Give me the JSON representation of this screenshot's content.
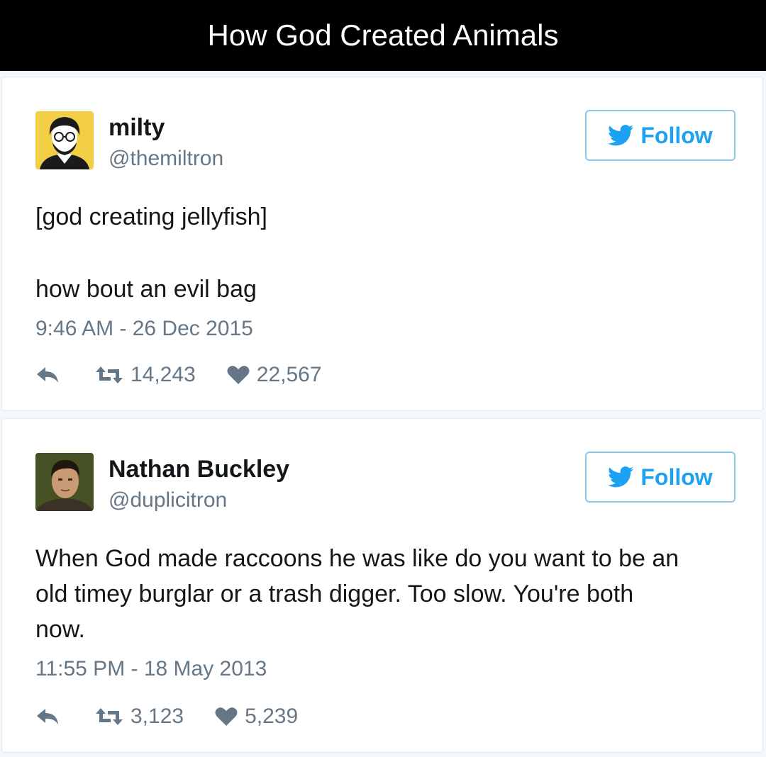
{
  "header": {
    "title": "How God Created Animals"
  },
  "tweets": [
    {
      "name": "milty",
      "handle": "@themiltron",
      "follow_label": "Follow",
      "text_line1": "[god creating jellyfish]",
      "text_line2": "how bout an evil bag",
      "timestamp": "9:46 AM - 26 Dec 2015",
      "retweets": "14,243",
      "likes": "22,567"
    },
    {
      "name": "Nathan Buckley",
      "handle": "@duplicitron",
      "follow_label": "Follow",
      "text_line1": "When God made raccoons he was like do you want to be an",
      "text_line2": "old timey burglar or a trash digger. Too slow. You're both",
      "text_line3": "now.",
      "timestamp": "11:55 PM - 18 May 2013",
      "retweets": "3,123",
      "likes": "5,239"
    }
  ],
  "colors": {
    "accent": "#1da1f2",
    "muted": "#657786",
    "text": "#14171a"
  },
  "icons": [
    "twitter-bird-icon",
    "reply-icon",
    "retweet-icon",
    "heart-icon"
  ]
}
